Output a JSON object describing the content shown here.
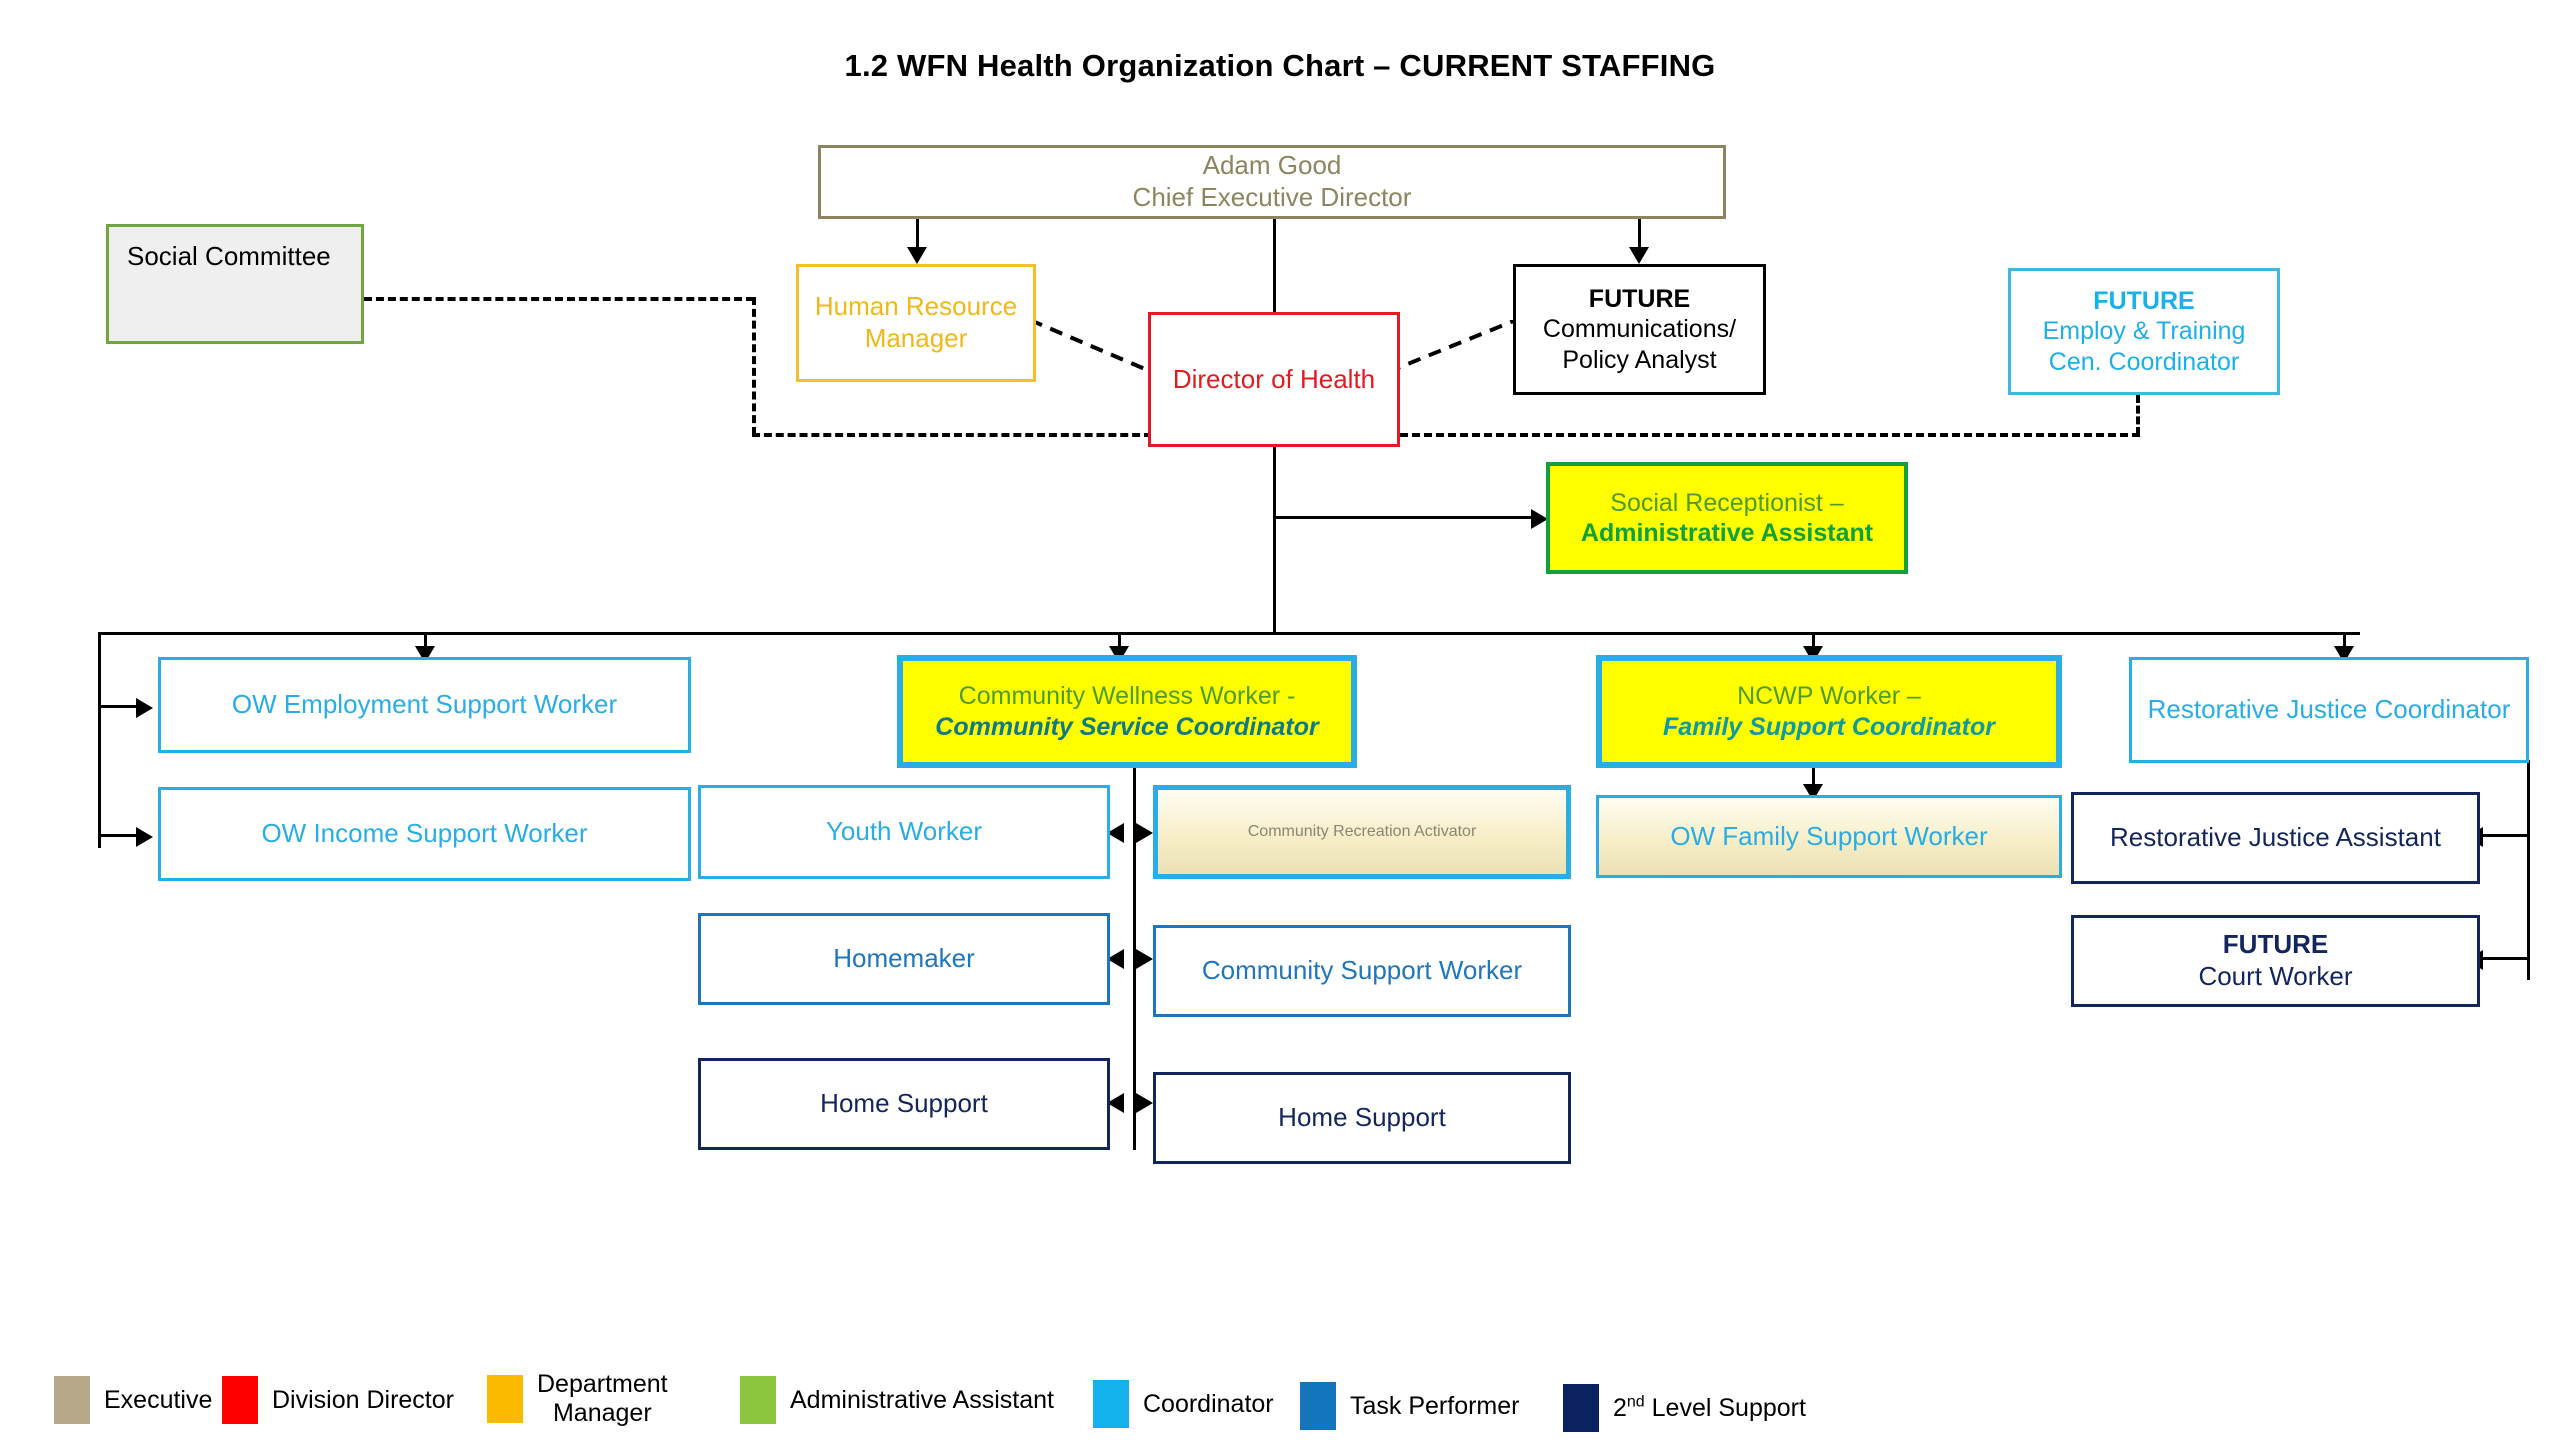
{
  "title": "1.2 WFN Health Organization Chart – CURRENT STAFFING",
  "nodes": {
    "ceo": {
      "line1": "Adam Good",
      "line2": "Chief Executive Director"
    },
    "social_cmte": {
      "line1": "Social Committee"
    },
    "hr_manager": {
      "line1": "Human Resource",
      "line2": "Manager"
    },
    "dir_health": {
      "line1": "Director of Health"
    },
    "future_comm": {
      "line1": "FUTURE",
      "line2": "Communications/",
      "line3": "Policy Analyst"
    },
    "future_employ": {
      "line1": "FUTURE",
      "line2": "Employ & Training",
      "line3": "Cen. Coordinator"
    },
    "social_recep": {
      "line1": "Social Receptionist –",
      "line2": "Administrative Assistant"
    },
    "ow_employ": {
      "line1": "OW Employment Support Worker"
    },
    "ow_income": {
      "line1": "OW Income Support Worker"
    },
    "cww": {
      "line1": "Community Wellness Worker -",
      "line2": "Community Service Coordinator"
    },
    "youth": {
      "line1": "Youth Worker"
    },
    "homemaker": {
      "line1": "Homemaker"
    },
    "home_sup_l": {
      "line1": "Home Support"
    },
    "crec": {
      "line1": "Community Recreation Activator"
    },
    "csw": {
      "line1": "Community Support Worker"
    },
    "home_sup_r": {
      "line1": "Home Support"
    },
    "ncwp": {
      "line1": "NCWP Worker –",
      "line2": "Family Support Coordinator"
    },
    "ow_family": {
      "line1": "OW Family Support Worker"
    },
    "rj_coord": {
      "line1": "Restorative Justice Coordinator"
    },
    "rj_assist": {
      "line1": "Restorative Justice Assistant"
    },
    "future_court": {
      "line1": "FUTURE",
      "line2": "Court Worker"
    }
  },
  "legend": {
    "items": [
      {
        "label": "Executive",
        "color": "#b5a98a"
      },
      {
        "label": "Division Director",
        "color": "#ff0000"
      },
      {
        "label": "Department",
        "label2": "Manager",
        "color": "#fbba00"
      },
      {
        "label": "Administrative Assistant",
        "color": "#8cc63e"
      },
      {
        "label": "Coordinator",
        "color": "#14b2ec"
      },
      {
        "label": "Task Performer",
        "color": "#1376bc"
      },
      {
        "label": "2nd Level Support",
        "color": "#0b2260"
      }
    ]
  }
}
